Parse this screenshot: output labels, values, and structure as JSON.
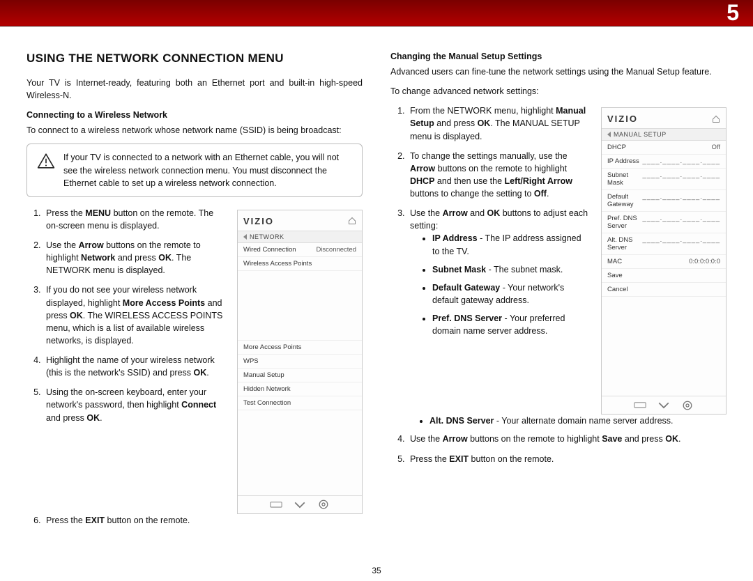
{
  "chapter_number": "5",
  "page_number": "35",
  "col1": {
    "heading": "USING THE NETWORK CONNECTION MENU",
    "intro": "Your TV is Internet-ready, featuring both an Ethernet port and built-in high-speed Wireless-N.",
    "sub1": "Connecting to a Wireless Network",
    "sub1_intro": "To connect to a wireless network whose network name (SSID) is being broadcast:",
    "note": "If your TV is connected to a network with an Ethernet cable, you will not see the wireless network connection menu. You must disconnect the Ethernet cable to set up a wireless network connection.",
    "steps": {
      "s1_a": "Press the ",
      "s1_b": "MENU",
      "s1_c": " button on the remote. The on-screen menu is displayed.",
      "s2_a": "Use the ",
      "s2_b": "Arrow",
      "s2_c": " buttons on the remote to highlight ",
      "s2_d": "Network",
      "s2_e": " and press ",
      "s2_f": "OK",
      "s2_g": ". The NETWORK menu is displayed.",
      "s3_a": "If you do not see your wireless network displayed, highlight ",
      "s3_b": "More Access Points",
      "s3_c": " and press ",
      "s3_d": "OK",
      "s3_e": ". The WIRELESS ACCESS POINTS menu, which is a list of available wireless networks, is displayed.",
      "s4_a": "Highlight the name of your wireless network (this is the network's SSID) and press ",
      "s4_b": "OK",
      "s4_c": ".",
      "s5_a": "Using the on-screen keyboard, enter your network's password, then highlight ",
      "s5_b": "Connect",
      "s5_c": " and press ",
      "s5_d": "OK",
      "s5_e": ".",
      "s6_a": "Press the ",
      "s6_b": "EXIT",
      "s6_c": " button on the remote."
    },
    "osd_network": {
      "brand": "VIZIO",
      "crumb": "NETWORK",
      "rows": {
        "wired_k": "Wired Connection",
        "wired_v": "Disconnected",
        "wap": "Wireless Access Points",
        "more": "More Access Points",
        "wps": "WPS",
        "manual": "Manual Setup",
        "hidden": "Hidden Network",
        "test": "Test Connection"
      }
    }
  },
  "col2": {
    "sub": "Changing the Manual Setup Settings",
    "intro1": "Advanced users can fine-tune the network settings using the Manual Setup feature.",
    "intro2": "To change advanced network settings:",
    "steps": {
      "s1_a": "From the NETWORK menu, highlight ",
      "s1_b": "Manual Setup",
      "s1_c": " and press ",
      "s1_d": "OK",
      "s1_e": ". The MANUAL SETUP menu is displayed.",
      "s2_a": "To change the settings manually, use the ",
      "s2_b": "Arrow",
      "s2_c": " buttons on the remote to highlight ",
      "s2_d": "DHCP",
      "s2_e": " and then use the ",
      "s2_f": "Left/Right Arrow",
      "s2_g": " buttons to change the setting to ",
      "s2_h": "Off",
      "s2_i": ".",
      "s3_a": "Use the ",
      "s3_b": "Arrow",
      "s3_c": " and ",
      "s3_d": "OK",
      "s3_e": " buttons to adjust each setting:",
      "b_ip_k": "IP Address",
      "b_ip_v": " - The IP address assigned to the TV.",
      "b_sm_k": "Subnet Mask",
      "b_sm_v": " - The subnet mask.",
      "b_dg_k": "Default Gateway",
      "b_dg_v": " - Your network's default gateway address.",
      "b_pd_k": "Pref. DNS Server",
      "b_pd_v": " - Your preferred domain name server address.",
      "b_ad_k": "Alt. DNS Server",
      "b_ad_v": " - Your alternate domain name server address.",
      "s4_a": "Use the ",
      "s4_b": "Arrow",
      "s4_c": " buttons on the remote to highlight ",
      "s4_d": "Save",
      "s4_e": " and press ",
      "s4_f": "OK",
      "s4_g": ".",
      "s5_a": "Press the ",
      "s5_b": "EXIT",
      "s5_c": " button on the remote."
    },
    "osd_manual": {
      "brand": "VIZIO",
      "crumb": "MANUAL SETUP",
      "rows": {
        "dhcp_k": "DHCP",
        "dhcp_v": "Off",
        "ip_k": "IP Address",
        "ip_v": "____.____.____.____",
        "sm_k": "Subnet Mask",
        "sm_v": "____.____.____.____",
        "dg_k": "Default Gateway",
        "dg_v": "____.____.____.____",
        "pd_k": "Pref. DNS Server",
        "pd_v": "____.____.____.____",
        "ad_k": "Alt. DNS Server",
        "ad_v": "____.____.____.____",
        "mac_k": "MAC",
        "mac_v": "0:0:0:0:0:0",
        "save": "Save",
        "cancel": "Cancel"
      }
    }
  }
}
